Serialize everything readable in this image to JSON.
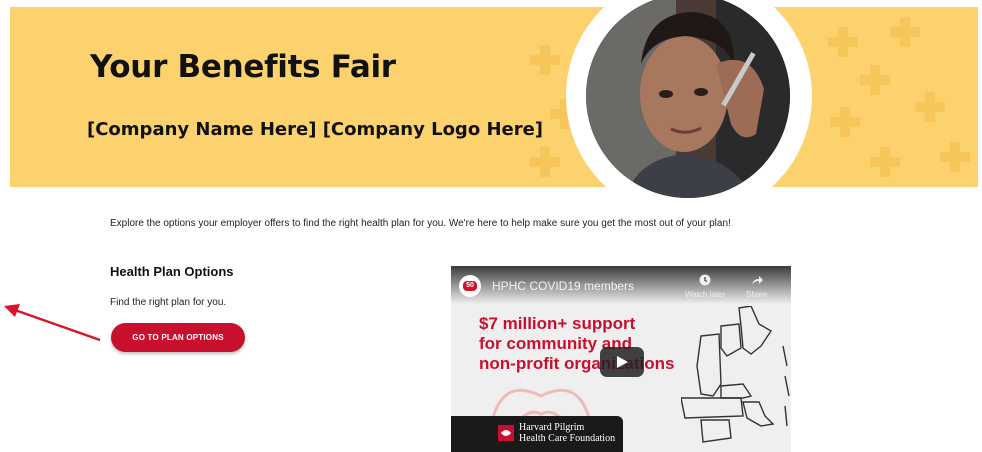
{
  "hero": {
    "title": "Your Benefits Fair",
    "subtitle": "[Company Name Here]  [Company Logo Here]",
    "background_color": "#fcd26f",
    "photo_description": "man-portrait-photo"
  },
  "intro": {
    "text": "Explore the options your employer offers to find the right health plan for you.  We're here to help make sure you get the most out of your plan!"
  },
  "plan_section": {
    "title": "Health Plan Options",
    "text": "Find the right plan for you.",
    "button_label": "GO TO PLAN OPTIONS",
    "button_color": "#c8102e"
  },
  "video": {
    "title": "HPHC COVID19 members",
    "channel_badge": "50",
    "watch_later_label": "Watch later",
    "share_label": "Share",
    "promo_lines": [
      "$7 million+ support",
      "for community and",
      "non-profit organizations"
    ],
    "foundation_name_line1": "Harvard Pilgrim",
    "foundation_name_line2": "Health Care Foundation",
    "accent_color": "#c8102e"
  },
  "annotation": {
    "arrow_color": "#d9142b"
  }
}
